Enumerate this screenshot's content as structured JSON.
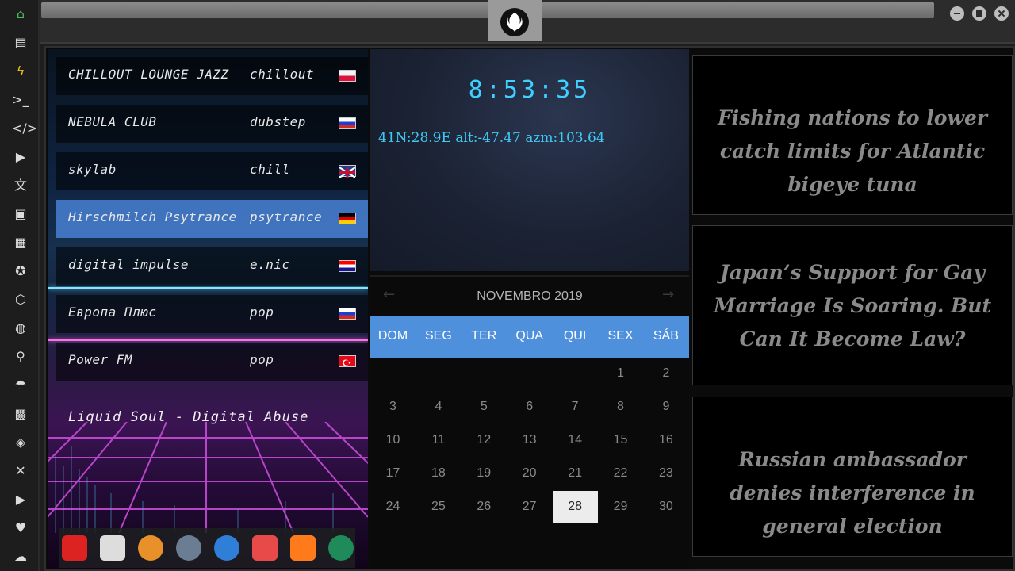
{
  "rail": {
    "icons": [
      "home-icon",
      "document-icon",
      "bolt-icon",
      "terminal-icon",
      "code-icon",
      "play-icon",
      "translate-icon",
      "image-icon",
      "news-icon",
      "rebel-icon",
      "hexagon-icon",
      "globe-icon",
      "search-icon",
      "umbrella-icon",
      "contacts-icon",
      "tag-icon",
      "tools-icon",
      "youtube-icon",
      "heart-icon",
      "cloud-icon"
    ],
    "glyphs": [
      "⌂",
      "▤",
      "ϟ",
      ">_",
      "</>",
      "▶",
      "文",
      "▣",
      "▦",
      "✪",
      "⬡",
      "◍",
      "⚲",
      "☂",
      "▩",
      "◈",
      "✕",
      "▶",
      "♥",
      "☁"
    ],
    "home_color": "#4cbb5a",
    "bolt_color": "#f5c518"
  },
  "radio": {
    "stations": [
      {
        "name": "CHILLOUT LOUNGE JAZZ",
        "genre": "chillout",
        "flag": "poland"
      },
      {
        "name": "NEBULA CLUB",
        "genre": "dubstep",
        "flag": "russia"
      },
      {
        "name": "skylab",
        "genre": "chill",
        "flag": "uk"
      },
      {
        "name": "Hirschmilch Psytrance",
        "genre": "psytrance",
        "flag": "germany"
      },
      {
        "name": "digital impulse",
        "genre": "e.nic",
        "flag": "croatia"
      },
      {
        "name": "Европа Плюс",
        "genre": "pop",
        "flag": "russia"
      },
      {
        "name": "Power FM",
        "genre": "pop",
        "flag": "turkey"
      }
    ],
    "active_index": 3,
    "now_playing": "Liquid Soul - Digital Abuse",
    "dock_icons": [
      "anydesk-icon",
      "newspaper-icon",
      "search-app-icon",
      "clock-app-icon",
      "globe-app-icon",
      "calendar-app-icon",
      "arrow-app-icon",
      "yandex-icon"
    ]
  },
  "clock": {
    "time": "8:53:35",
    "coords": "41N:28.9E  alt:-47.47 azm:103.64"
  },
  "calendar": {
    "month_label": "NOVEMBRO 2019",
    "prev": "←",
    "next": "→",
    "weekdays": [
      "DOM",
      "SEG",
      "TER",
      "QUA",
      "QUI",
      "SEX",
      "SÁB"
    ],
    "weeks": [
      [
        "",
        "",
        "",
        "",
        "",
        "1",
        "2"
      ],
      [
        "3",
        "4",
        "5",
        "6",
        "7",
        "8",
        "9"
      ],
      [
        "10",
        "11",
        "12",
        "13",
        "14",
        "15",
        "16"
      ],
      [
        "17",
        "18",
        "19",
        "20",
        "21",
        "22",
        "23"
      ],
      [
        "24",
        "25",
        "26",
        "27",
        "28",
        "29",
        "30"
      ]
    ],
    "today": "28"
  },
  "news": [
    {
      "headline": "Fishing nations to lower catch limits for Atlantic bigeye tuna"
    },
    {
      "headline": "Japan’s Support for Gay Marriage Is Soaring. But Can It Become Law?"
    },
    {
      "headline": "Russian ambassador denies interference in general election"
    }
  ]
}
